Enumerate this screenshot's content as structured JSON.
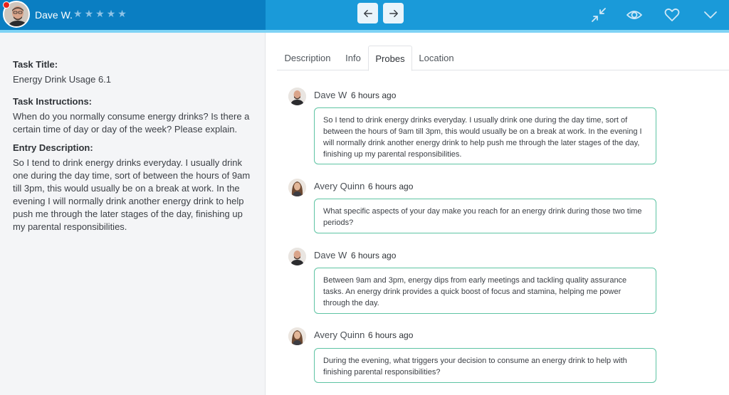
{
  "header": {
    "user_name": "Dave W.",
    "rating_stars": 5,
    "colors": {
      "left": "#0a7ec2",
      "right": "#1a9ad9",
      "stripe": "#7fd3f5",
      "presence": "#e8231a"
    },
    "icons": [
      "arrow-left-icon",
      "arrow-right-icon",
      "collapse-icon",
      "eye-icon",
      "heart-icon",
      "chevron-down-icon"
    ]
  },
  "task": {
    "title_label": "Task Title:",
    "title_value": "Energy Drink Usage 6.1",
    "instructions_label": "Task Instructions:",
    "instructions_value": "When do you normally consume energy drinks? Is there a certain time of day or day of the week? Please explain.",
    "entry_label": "Entry Description:",
    "entry_value": "So I tend to drink energy drinks everyday. I usually drink one during the day time, sort of between the hours of 9am till 3pm, this would usually be on a break at work. In the evening I will normally drink another energy drink to help push me through the later stages of the day, finishing up my parental responsibilities."
  },
  "tabs": [
    {
      "label": "Description",
      "active": false
    },
    {
      "label": "Info",
      "active": false
    },
    {
      "label": "Probes",
      "active": true
    },
    {
      "label": "Location",
      "active": false
    }
  ],
  "messages": [
    {
      "author": "Dave W",
      "time": "6 hours ago",
      "text": "So I tend to drink energy drinks everyday. I usually drink one during the day time, sort of between the hours of 9am till 3pm, this would usually be on a break at work. In the evening I will normally drink another energy drink to help push me through the later stages of the day, finishing up my parental responsibilities."
    },
    {
      "author": "Avery Quinn",
      "time": "6 hours ago",
      "text": "What specific aspects of your day make you reach for an energy drink during those two time periods?"
    },
    {
      "author": "Dave W",
      "time": "6 hours ago",
      "text": "Between 9am and 3pm, energy dips from early meetings and tackling quality assurance tasks. An energy drink provides a quick boost of focus and stamina, helping me power through the day."
    },
    {
      "author": "Avery Quinn",
      "time": "6 hours ago",
      "text": "During the evening, what triggers your decision to consume an energy drink to help with finishing parental responsibilities?"
    }
  ]
}
